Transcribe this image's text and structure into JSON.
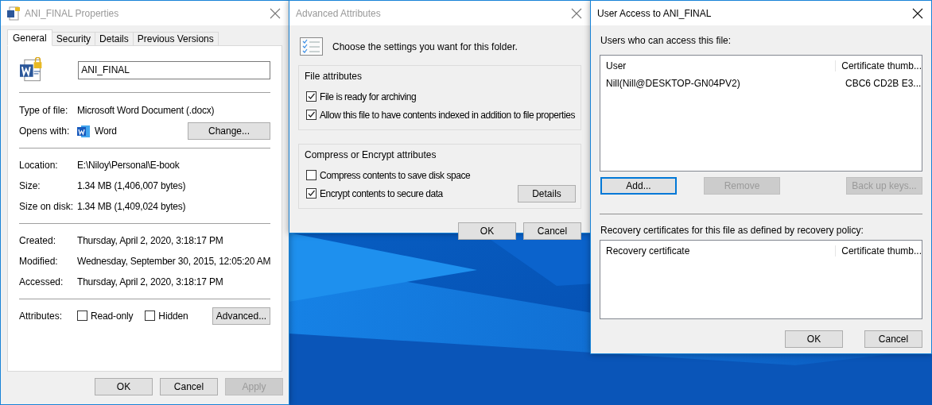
{
  "properties": {
    "title": "ANI_FINAL Properties",
    "active": false,
    "tabs": [
      {
        "label": "General",
        "selected": true
      },
      {
        "label": "Security",
        "selected": false
      },
      {
        "label": "Details",
        "selected": false
      },
      {
        "label": "Previous Versions",
        "selected": false
      }
    ],
    "file_name": "ANI_FINAL",
    "sections": [
      [
        {
          "label": "Type of file:",
          "value": "Microsoft Word Document (.docx)"
        },
        {
          "label": "Opens with:",
          "value": "Word",
          "kind": "app",
          "button": "Change..."
        }
      ],
      [
        {
          "label": "Location:",
          "value": "E:\\Niloy\\Personal\\E-book"
        },
        {
          "label": "Size:",
          "value": "1.34 MB (1,406,007 bytes)"
        },
        {
          "label": "Size on disk:",
          "value": "1.34 MB (1,409,024 bytes)"
        }
      ],
      [
        {
          "label": "Created:",
          "value": "Thursday, April 2, 2020, 3:18:17 PM"
        },
        {
          "label": "Modified:",
          "value": "Wednesday, September 30, 2015, 12:05:20 AM"
        },
        {
          "label": "Accessed:",
          "value": "Thursday, April 2, 2020, 3:18:17 PM"
        }
      ]
    ],
    "attributes": {
      "label": "Attributes:",
      "options": [
        {
          "label": "Read-only",
          "checked": false
        },
        {
          "label": "Hidden",
          "checked": false
        }
      ],
      "button": "Advanced..."
    },
    "buttons": [
      {
        "label": "OK",
        "disabled": false
      },
      {
        "label": "Cancel",
        "disabled": false
      },
      {
        "label": "Apply",
        "disabled": true
      }
    ]
  },
  "advanced": {
    "title": "Advanced Attributes",
    "active": false,
    "intro": "Choose the settings you want for this folder.",
    "groups": [
      {
        "title": "File attributes",
        "options": [
          {
            "label": "File is ready for archiving",
            "checked": true
          },
          {
            "label": "Allow this file to have contents indexed in addition to file properties",
            "checked": true
          }
        ]
      },
      {
        "title": "Compress or Encrypt attributes",
        "options": [
          {
            "label": "Compress contents to save disk space",
            "checked": false
          },
          {
            "label": "Encrypt contents to secure data",
            "checked": true
          }
        ],
        "button": "Details"
      }
    ],
    "buttons": [
      {
        "label": "OK",
        "disabled": false
      },
      {
        "label": "Cancel",
        "disabled": false
      }
    ]
  },
  "user_access": {
    "title": "User Access to ANI_FINAL",
    "active": true,
    "users_label": "Users who can access this file:",
    "users_table": {
      "columns": [
        "User",
        "Certificate thumb..."
      ],
      "rows": [
        [
          "Nill(Nill@DESKTOP-GN04PV2)",
          "CBC6 CD2B E3..."
        ]
      ]
    },
    "user_buttons": [
      {
        "label": "Add...",
        "disabled": false,
        "focused": true
      },
      {
        "label": "Remove",
        "disabled": true,
        "focused": false
      },
      {
        "label": "Back up keys...",
        "disabled": true,
        "focused": false
      }
    ],
    "recovery_label": "Recovery certificates for this file as defined by recovery policy:",
    "recovery_table": {
      "columns": [
        "Recovery certificate",
        "Certificate thumb..."
      ]
    },
    "buttons": [
      {
        "label": "OK",
        "disabled": false
      },
      {
        "label": "Cancel",
        "disabled": false
      }
    ]
  }
}
